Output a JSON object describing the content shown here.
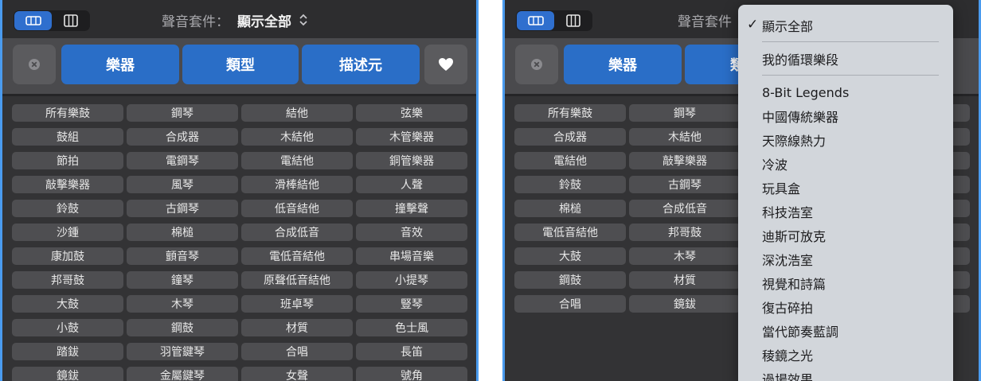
{
  "sound_pack": {
    "label": "聲音套件：",
    "label_short": "聲音套件",
    "value": "顯示全部"
  },
  "filter": {
    "tabs": [
      "樂器",
      "類型",
      "描述元"
    ],
    "clear_icon": "clear-x-icon",
    "favorite_icon": "heart-icon"
  },
  "keywords": [
    [
      "所有樂鼓",
      "鋼琴",
      "結他",
      "弦樂"
    ],
    [
      "鼓組",
      "合成器",
      "木結他",
      "木管樂器"
    ],
    [
      "節拍",
      "電鋼琴",
      "電結他",
      "銅管樂器"
    ],
    [
      "敲擊樂器",
      "風琴",
      "滑棒結他",
      "人聲"
    ],
    [
      "鈴鼓",
      "古鋼琴",
      "低音結他",
      "撞擊聲"
    ],
    [
      "沙鍾",
      "棉槌",
      "合成低音",
      "音效"
    ],
    [
      "康加鼓",
      "顫音琴",
      "電低音結他",
      "串場音樂"
    ],
    [
      "邦哥鼓",
      "鐘琴",
      "原聲低音結他",
      "小提琴"
    ],
    [
      "大鼓",
      "木琴",
      "班卓琴",
      "豎琴"
    ],
    [
      "小鼓",
      "鋼鼓",
      "材質",
      "色士風"
    ],
    [
      "踏鈸",
      "羽管鍵琴",
      "合唱",
      "長笛"
    ],
    [
      "鏡鈸",
      "金屬鍵琴",
      "女聲",
      "號角"
    ]
  ],
  "dropdown": {
    "selected": "顯示全部",
    "loops": "我的循環樂段",
    "packs": [
      "8-Bit Legends",
      "中國傳統樂器",
      "天際線熱力",
      "冷波",
      "玩具盒",
      "科技浩室",
      "迪斯可放克",
      "深沈浩室",
      "視覺和詩篇",
      "復古碎拍",
      "當代節奏藍調",
      "稜鏡之光",
      "過場效果"
    ]
  },
  "colors": {
    "accent": "#2a6ec7",
    "panel_bg": "#333335",
    "border_highlight": "#4a9bef",
    "menu_bg": "#d2d6db"
  }
}
